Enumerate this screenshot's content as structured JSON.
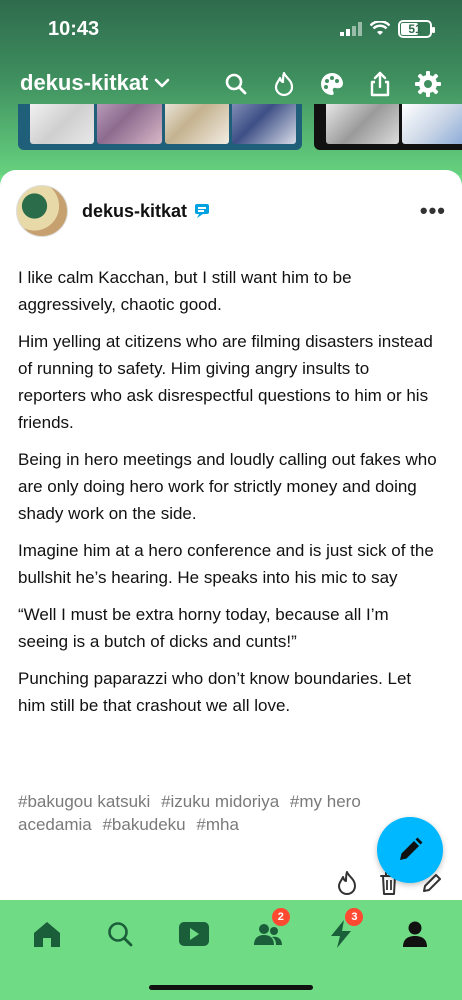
{
  "status": {
    "time": "10:43",
    "battery": "51"
  },
  "header": {
    "blog_name": "dekus-kitkat",
    "icons": [
      "search-icon",
      "flame-icon",
      "palette-icon",
      "share-icon",
      "gear-icon"
    ]
  },
  "post": {
    "author": "dekus-kitkat",
    "paragraphs": [
      "I like calm Kacchan, but I still want him to be aggressively, chaotic good.",
      "Him yelling at citizens who are filming disasters instead of running to safety. Him giving angry insults to reporters who ask disrespectful questions to him or his friends.",
      "Being in hero meetings and loudly calling out fakes who are only doing hero work for strictly money and doing shady work on the side.",
      "Imagine him at a hero conference and is just sick of the bullshit he’s hearing. He speaks into his mic to say",
      "“Well I must be extra horny today, because all I’m seeing is a butch of dicks and cunts!”",
      "Punching paparazzi who don’t know boundaries. Let him still be that crashout we all love."
    ],
    "tags": [
      "#bakugou katsuki",
      "#izuku midoriya",
      "#my hero acedamia",
      "#bakudeku",
      "#mha"
    ]
  },
  "nav": {
    "items": [
      "home-icon",
      "search-icon",
      "video-icon",
      "people-icon",
      "activity-icon",
      "account-icon"
    ],
    "badges": {
      "people": "2",
      "activity": "3"
    }
  },
  "colors": {
    "accent": "#6fdc85",
    "fab": "#00b8ff",
    "badge": "#ff4930"
  }
}
